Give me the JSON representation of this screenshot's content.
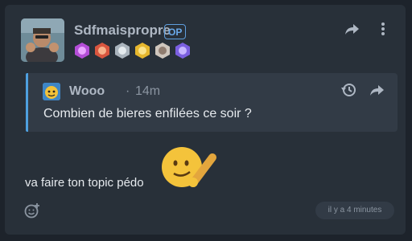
{
  "post": {
    "author": "Sdfmaispropre",
    "op_badge": "OP",
    "badges": [
      "purple-badge",
      "red-badge",
      "silver-badge",
      "yellow-badge",
      "white-badge",
      "violet-badge"
    ],
    "body_text": "va faire ton topic pédo",
    "timestamp": "il y a 4 minutes",
    "quote": {
      "author": "Wooo",
      "separator": "·",
      "time": "14m",
      "text": "Combien de bieres enfilées ce soir ?"
    }
  },
  "colors": {
    "background": "#1d232b",
    "card": "#283039",
    "accent": "#4ea0e0"
  }
}
